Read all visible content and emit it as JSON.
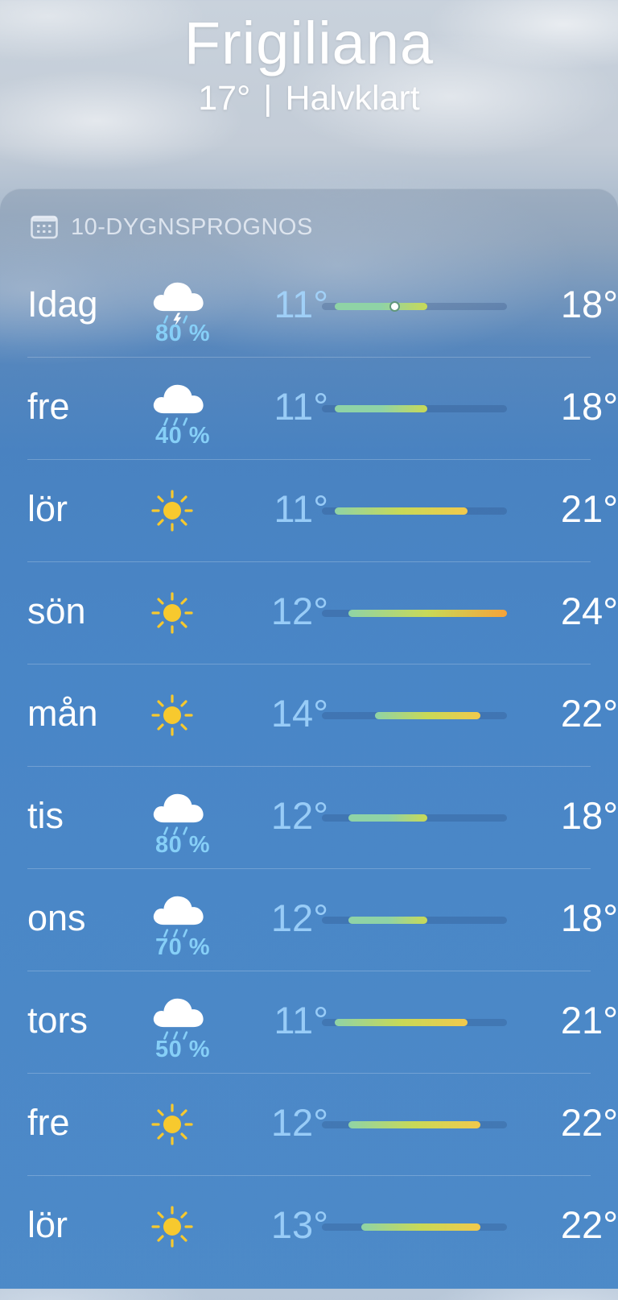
{
  "header": {
    "city": "Frigiliana",
    "current_temp": "17°",
    "separator": "|",
    "condition": "Halvklart"
  },
  "forecast": {
    "title": "10-DYGNSPROGNOS",
    "title_icon": "calendar-icon",
    "days": [
      {
        "day": "Idag",
        "icon": "cloud-bolt-rain-icon",
        "precip": "80 %",
        "low": "11°",
        "high": "18°",
        "low_value": 11,
        "high_value": 18,
        "current_value": 15.5
      },
      {
        "day": "fre",
        "icon": "cloud-rain-icon",
        "precip": "40 %",
        "low": "11°",
        "high": "18°",
        "low_value": 11,
        "high_value": 18
      },
      {
        "day": "lör",
        "icon": "sun-icon",
        "precip": "",
        "low": "11°",
        "high": "21°",
        "low_value": 11,
        "high_value": 21
      },
      {
        "day": "sön",
        "icon": "sun-icon",
        "precip": "",
        "low": "12°",
        "high": "24°",
        "low_value": 12,
        "high_value": 24
      },
      {
        "day": "mån",
        "icon": "sun-icon",
        "precip": "",
        "low": "14°",
        "high": "22°",
        "low_value": 14,
        "high_value": 22
      },
      {
        "day": "tis",
        "icon": "cloud-rain-icon",
        "precip": "80 %",
        "low": "12°",
        "high": "18°",
        "low_value": 12,
        "high_value": 18
      },
      {
        "day": "ons",
        "icon": "cloud-rain-icon",
        "precip": "70 %",
        "low": "12°",
        "high": "18°",
        "low_value": 12,
        "high_value": 18
      },
      {
        "day": "tors",
        "icon": "cloud-rain-icon",
        "precip": "50 %",
        "low": "11°",
        "high": "21°",
        "low_value": 11,
        "high_value": 21
      },
      {
        "day": "fre",
        "icon": "sun-icon",
        "precip": "",
        "low": "12°",
        "high": "22°",
        "low_value": 12,
        "high_value": 22
      },
      {
        "day": "lör",
        "icon": "sun-icon",
        "precip": "",
        "low": "13°",
        "high": "22°",
        "low_value": 13,
        "high_value": 22
      }
    ],
    "range_min": 10,
    "range_max": 24
  },
  "colors": {
    "precip_text": "#86cff7",
    "bar_cool": "#8fd3a6",
    "bar_mild": "#c8d957",
    "bar_warm": "#f2c94c",
    "bar_hot": "#f5a33a",
    "sun": "#f7c92e"
  }
}
